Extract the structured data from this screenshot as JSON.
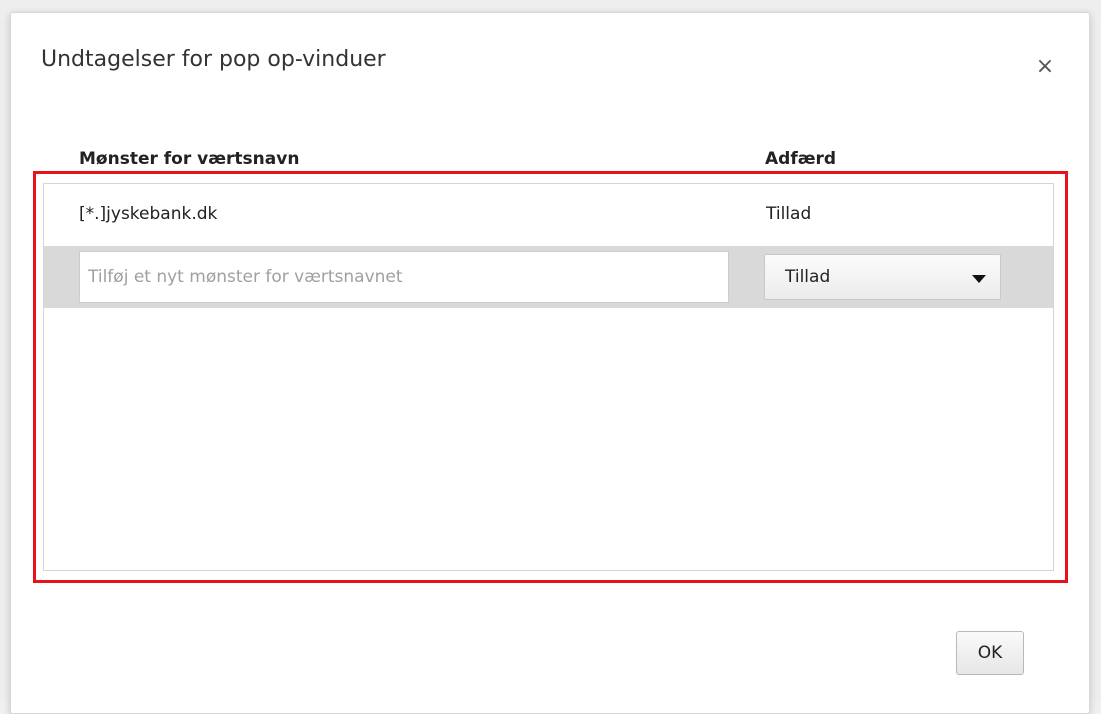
{
  "dialog": {
    "title": "Undtagelser for pop op-vinduer",
    "close_symbol": "×"
  },
  "table": {
    "columns": {
      "pattern": "Mønster for værtsnavn",
      "behavior": "Adfærd"
    },
    "rows": [
      {
        "pattern": "[*.]jyskebank.dk",
        "behavior": "Tillad"
      }
    ],
    "new_entry": {
      "placeholder": "Tilføj et nyt mønster for værtsnavnet",
      "value": "",
      "behavior_selected": "Tillad"
    }
  },
  "footer": {
    "ok_label": "OK"
  },
  "colors": {
    "highlight_border": "#e8131a",
    "new_row_background": "#d9d9d9"
  },
  "icons": {
    "close": "close-icon",
    "dropdown": "chevron-down-icon"
  }
}
